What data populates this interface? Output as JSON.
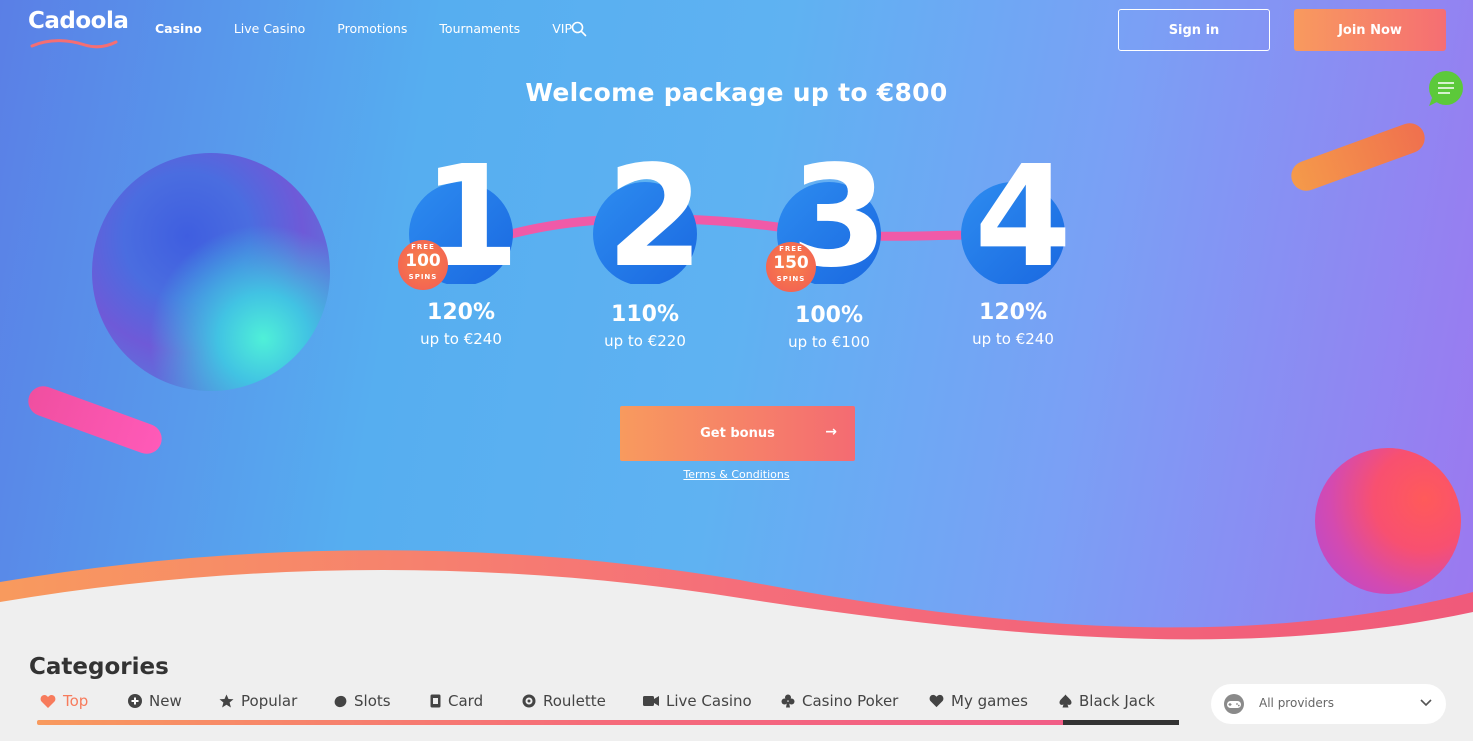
{
  "header": {
    "logo_text": "Cadoola",
    "nav": [
      "Casino",
      "Live Casino",
      "Promotions",
      "Tournaments",
      "VIP"
    ],
    "sign_in": "Sign in",
    "join_now": "Join Now"
  },
  "hero": {
    "headline": "Welcome package up to €800",
    "steps": [
      {
        "number": "1",
        "percent": "120%",
        "caption": "up to €240",
        "badge": {
          "free": "FREE",
          "count": "100",
          "spins": "SPINS"
        }
      },
      {
        "number": "2",
        "percent": "110%",
        "caption": "up to €220"
      },
      {
        "number": "3",
        "percent": "100%",
        "caption": "up to €100",
        "badge": {
          "free": "FREE",
          "count": "150",
          "spins": "SPINS"
        }
      },
      {
        "number": "4",
        "percent": "120%",
        "caption": "up to €240"
      }
    ],
    "cta": "Get bonus",
    "terms": "Terms & Conditions"
  },
  "categories": {
    "title": "Categories",
    "items": [
      {
        "label": "Top",
        "icon": "heart-icon",
        "active": true
      },
      {
        "label": "New",
        "icon": "plus-circle-icon"
      },
      {
        "label": "Popular",
        "icon": "star-icon"
      },
      {
        "label": "Slots",
        "icon": "slots-icon"
      },
      {
        "label": "Card",
        "icon": "card-icon"
      },
      {
        "label": "Roulette",
        "icon": "roulette-icon"
      },
      {
        "label": "Live Casino",
        "icon": "camera-icon"
      },
      {
        "label": "Casino Poker",
        "icon": "club-icon"
      },
      {
        "label": "My games",
        "icon": "heart-icon"
      },
      {
        "label": "Black Jack",
        "icon": "spade-icon"
      }
    ],
    "providers_placeholder": "All providers"
  },
  "colors": {
    "accent_orange": "#f89a5e",
    "accent_pink": "#f56e73",
    "active_category": "#f77b5c"
  }
}
